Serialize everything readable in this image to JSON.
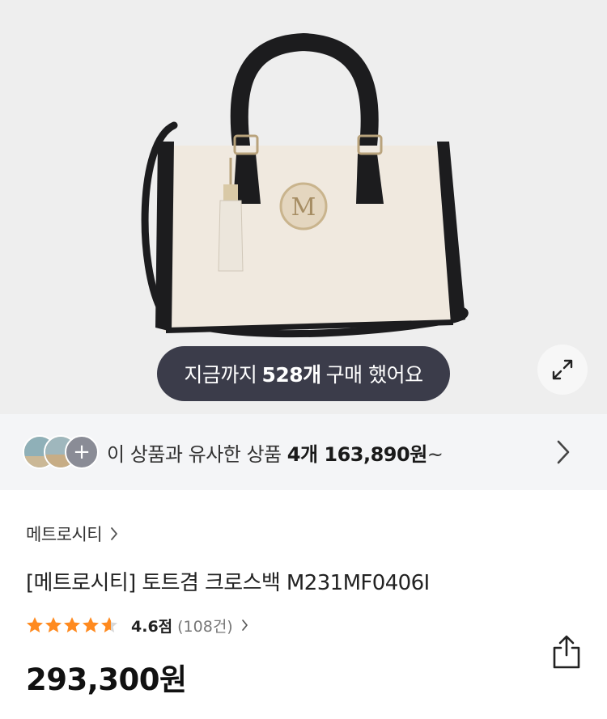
{
  "hero": {
    "purchase_pill": {
      "prefix": "지금까지",
      "count": "528개",
      "suffix": "구매 했어요"
    },
    "expand_icon": "expand-diagonal-arrows"
  },
  "similar": {
    "text_prefix": "이 상품과 유사한 상품",
    "count_price": "4개 163,890원",
    "suffix": "~",
    "plus_symbol": "+"
  },
  "product": {
    "brand": "메트로시티",
    "title": "[메트로시티] 토트겸 크로스백 M231MF0406I",
    "rating_score": "4.6점",
    "review_count": "(108건)",
    "rating_value": 4.6,
    "rating_max": 5,
    "price": "293,300원"
  },
  "colors": {
    "hero_bg": "#eeeeee",
    "pill_bg": "#3b3c4a",
    "star": "#ff8a1f",
    "similar_bg": "#f4f5f7"
  }
}
